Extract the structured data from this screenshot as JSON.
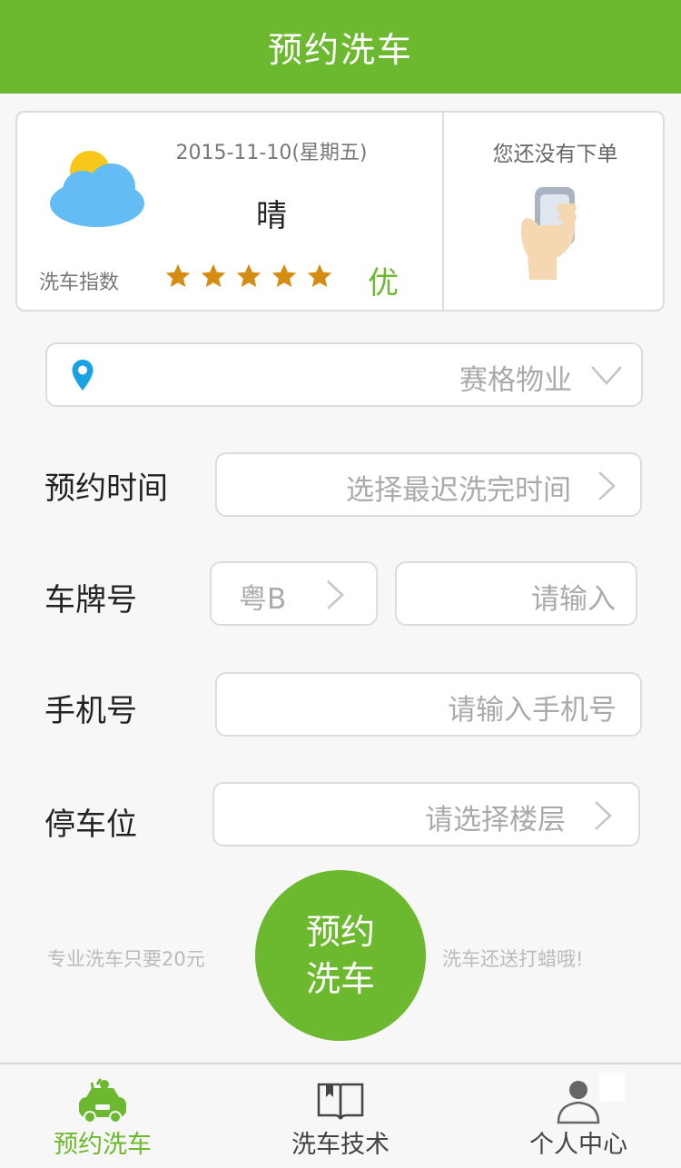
{
  "header": {
    "title": "预约洗车"
  },
  "weather_card": {
    "date": "2015-11-10(星期五)",
    "weather": "晴",
    "weather_icon": "sun-behind-cloud-icon",
    "wash_index_label": "洗车指数",
    "wash_index_rating": 5,
    "wash_index_rating_max": 5,
    "wash_index_grade": "优",
    "order_status": "您还没有下单",
    "order_icon": "hand-holding-phone-icon"
  },
  "location": {
    "value": "赛格物业"
  },
  "form": {
    "time": {
      "label": "预约时间",
      "placeholder": "选择最迟洗完时间"
    },
    "plate": {
      "label": "车牌号",
      "prefix": "粤B",
      "placeholder": "请输入"
    },
    "phone": {
      "label": "手机号",
      "placeholder": "请输入手机号"
    },
    "parking": {
      "label": "停车位",
      "placeholder": "请选择楼层"
    }
  },
  "promo": {
    "left": "专业洗车只要20元",
    "right": "洗车还送打蜡哦!"
  },
  "book_button": {
    "line1": "预约",
    "line2": "洗车"
  },
  "tabs": [
    {
      "label": "预约洗车",
      "icon": "car-wash-icon",
      "active": true
    },
    {
      "label": "洗车技术",
      "icon": "book-icon",
      "active": false
    },
    {
      "label": "个人中心",
      "icon": "user-icon",
      "active": false
    }
  ],
  "colors": {
    "primary": "#6cb82f",
    "star": "#d58c12",
    "placeholder": "#aaaaaa"
  }
}
